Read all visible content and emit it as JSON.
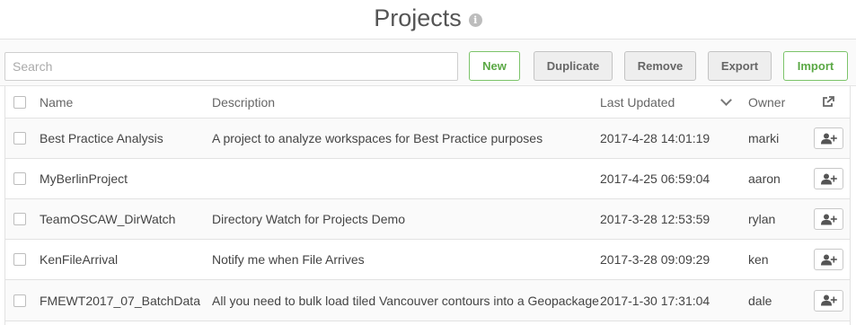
{
  "header": {
    "title": "Projects",
    "info_icon": "i"
  },
  "toolbar": {
    "search_placeholder": "Search",
    "new_label": "New",
    "duplicate_label": "Duplicate",
    "remove_label": "Remove",
    "export_label": "Export",
    "import_label": "Import"
  },
  "table": {
    "columns": {
      "name": "Name",
      "description": "Description",
      "last_updated": "Last Updated",
      "owner": "Owner"
    },
    "sort_icon": "chevron-down-icon",
    "export_icon": "export-icon",
    "share_icon": "add-user-icon",
    "rows": [
      {
        "name": "Best Practice Analysis",
        "description": "A project to analyze workspaces for Best Practice purposes",
        "last_updated": "2017-4-28 14:01:19",
        "owner": "marki"
      },
      {
        "name": "MyBerlinProject",
        "description": "",
        "last_updated": "2017-4-25 06:59:04",
        "owner": "aaron"
      },
      {
        "name": "TeamOSCAW_DirWatch",
        "description": "Directory Watch for Projects Demo",
        "last_updated": "2017-3-28 12:53:59",
        "owner": "rylan"
      },
      {
        "name": "KenFileArrival",
        "description": "Notify me when File Arrives",
        "last_updated": "2017-3-28 09:09:29",
        "owner": "ken"
      },
      {
        "name": "FMEWT2017_07_BatchData",
        "description": "All you need to bulk load tiled Vancouver contours into a Geopackage",
        "last_updated": "2017-1-30 17:31:04",
        "owner": "dale"
      }
    ]
  },
  "colors": {
    "accent_green": "#5aa844",
    "border_green": "#7cc46a",
    "button_gray": "#eeeeee"
  }
}
